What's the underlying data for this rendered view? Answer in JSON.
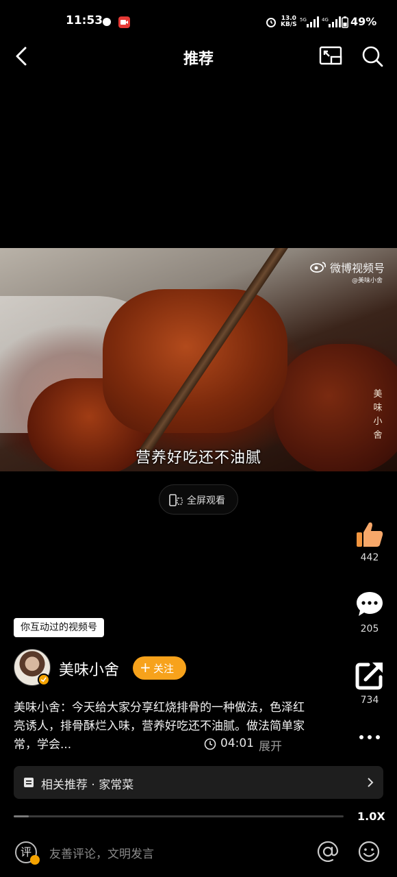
{
  "status_bar": {
    "time": "11:53",
    "net_speed_value": "13.0",
    "net_speed_unit": "KB/S",
    "battery": "49%",
    "icons": [
      "notification-icon",
      "record-icon",
      "alarm-icon",
      "signal-5g-icon",
      "signal-4g-icon",
      "battery-icon"
    ]
  },
  "header": {
    "title": "推荐",
    "icons": [
      "back-icon",
      "pip-icon",
      "search-icon"
    ]
  },
  "video": {
    "watermark": "微博视频号",
    "watermark_sub": "@美味小舍",
    "vertical_mark": "美味小舍",
    "subtitle": "营养好吃还不油腻",
    "fullscreen_label": "全屏观看"
  },
  "actions": {
    "like_count": "442",
    "comment_count": "205",
    "share_count": "734"
  },
  "author": {
    "tag": "你互动过的视频号",
    "name": "美味小舍",
    "follow_label": "关注",
    "description": "美味小舍：今天给大家分享红烧排骨的一种做法，色泽红亮诱人，排骨酥烂入味，营养好吃还不油腻。做法简单家常，学会...",
    "duration": "04:01",
    "expand_label": "展开"
  },
  "related": {
    "label": "相关推荐 · 家常菜"
  },
  "playback": {
    "progress": 0.045,
    "speed": "1.0X"
  },
  "comment_bar": {
    "avatar_char": "评",
    "placeholder": "友善评论，文明发言"
  },
  "colors": {
    "accent": "#f7a21b",
    "background": "#000000",
    "record": "#e53935"
  }
}
